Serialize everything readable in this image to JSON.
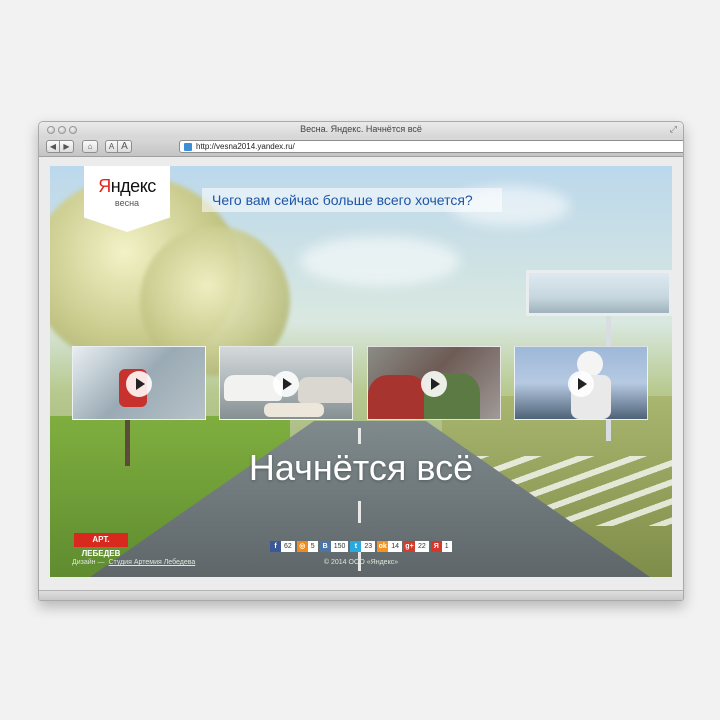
{
  "window": {
    "title": "Весна. Яндекс. Начнётся всё",
    "url": "http://vesna2014.yandex.ru/"
  },
  "toolbar": {
    "back_icon": "◀",
    "forward_icon": "▶",
    "home_icon": "⌂",
    "font_small": "A",
    "font_large": "A"
  },
  "page": {
    "logo": {
      "first_letter": "Я",
      "rest": "ндекс",
      "subtitle": "весна"
    },
    "question": "Чего вам сейчас больше всего хочется?",
    "headline": "Начнётся всё",
    "studio_logo": "АРТ. ЛЕБЕДЕВ",
    "footer": {
      "left_text": "Дизайн —",
      "left_link": "Студия Артемия Лебедева",
      "center": "© 2014 ООО «Яндекс»"
    },
    "videos": [
      {
        "label": "skier-video"
      },
      {
        "label": "taxi-geese-video"
      },
      {
        "label": "couple-sleeping-video"
      },
      {
        "label": "skater-video"
      }
    ],
    "shares": [
      {
        "icon": "f",
        "count": "62",
        "color": "#3b5998"
      },
      {
        "icon": "◎",
        "count": "5",
        "color": "#f08a1d"
      },
      {
        "icon": "B",
        "count": "150",
        "color": "#4c75a3"
      },
      {
        "icon": "t",
        "count": "23",
        "color": "#2aa9e0"
      },
      {
        "icon": "ok",
        "count": "14",
        "color": "#f29322"
      },
      {
        "icon": "g+",
        "count": "22",
        "color": "#d23e2b"
      },
      {
        "icon": "Я",
        "count": "1",
        "color": "#d8362a"
      }
    ]
  }
}
